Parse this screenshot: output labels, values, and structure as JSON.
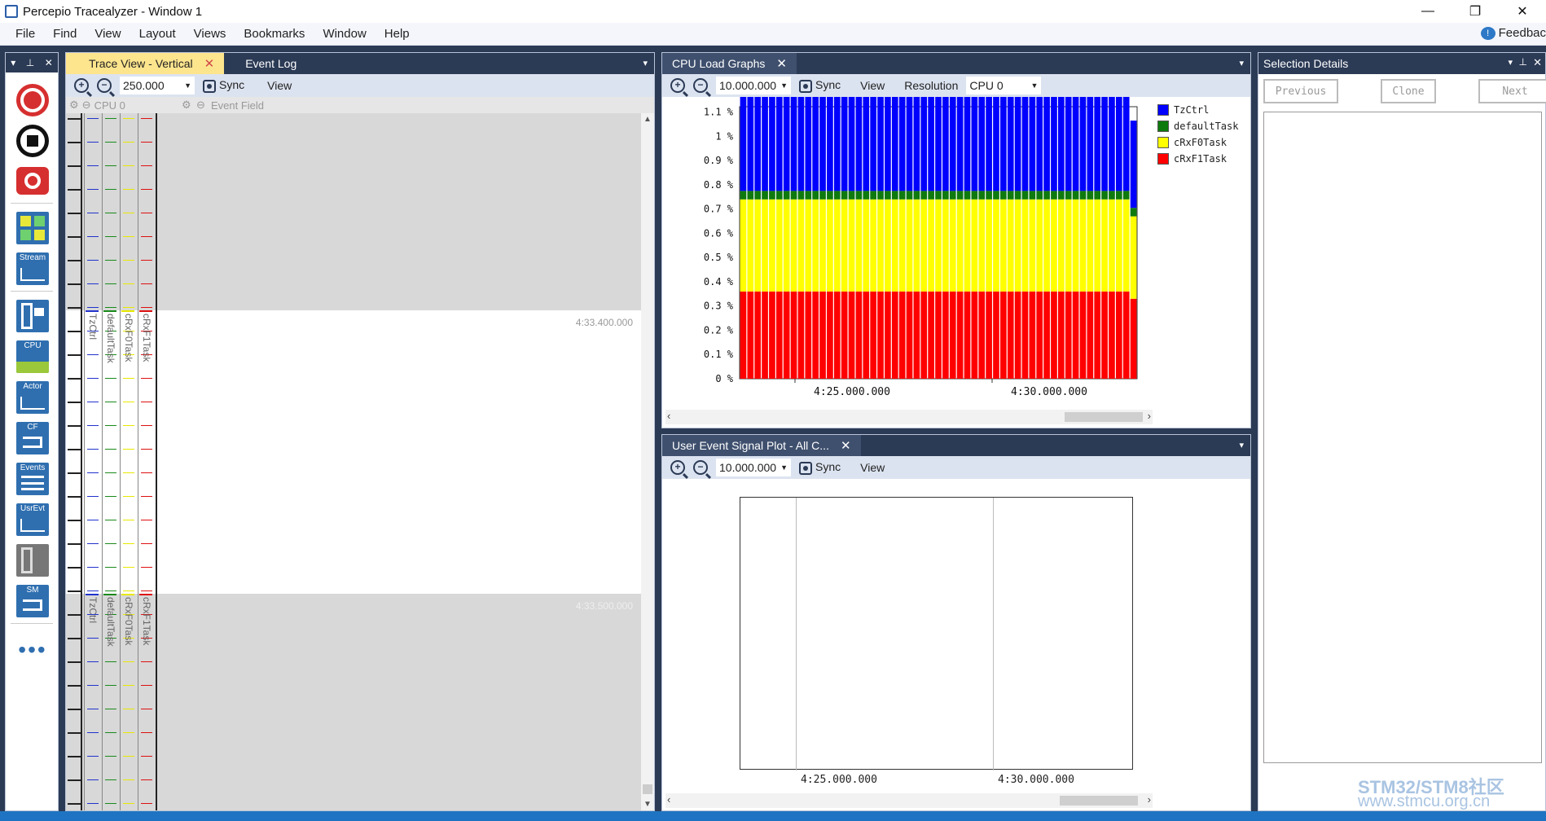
{
  "app": {
    "title": "Percepio Tracealyzer - Window 1",
    "win_min": "—",
    "win_max": "❐",
    "win_close": "✕"
  },
  "menu": [
    "File",
    "Find",
    "View",
    "Layout",
    "Views",
    "Bookmarks",
    "Window",
    "Help"
  ],
  "feedback": {
    "label": "Feedbac",
    "icon": "feedback-icon"
  },
  "toolbox": {
    "header_icons": [
      "dropdown-icon",
      "pin-icon",
      "close-icon"
    ],
    "tools": [
      {
        "name": "record-icon"
      },
      {
        "name": "stop-icon"
      },
      {
        "name": "snapshot-icon"
      },
      {
        "name": "dashboard-icon"
      },
      {
        "name": "stream-icon",
        "label": "Stream"
      },
      {
        "name": "trace-view-icon"
      },
      {
        "name": "cpu-load-icon",
        "label": "CPU"
      },
      {
        "name": "actor-icon",
        "label": "Actor"
      },
      {
        "name": "communication-flow-icon",
        "label": "CF"
      },
      {
        "name": "events-icon",
        "label": "Events"
      },
      {
        "name": "user-events-icon",
        "label": "UsrEvt"
      },
      {
        "name": "object-history-icon"
      },
      {
        "name": "state-machine-icon",
        "label": "SM"
      },
      {
        "name": "more-icon",
        "label": "•••"
      }
    ]
  },
  "trace_panel": {
    "tabs": [
      {
        "label": "Trace View - Vertical",
        "close": "✕"
      },
      {
        "label": "Event Log"
      }
    ],
    "zoom_value": "250.000",
    "sync_label": "Sync",
    "view_label": "View",
    "header_cpu": "CPU 0",
    "header_field": "Event Field",
    "timestamps": [
      "4:33.400.000",
      "4:33.500.000"
    ],
    "lanes": [
      {
        "name": "TzCtrl",
        "color": "#2233cc"
      },
      {
        "name": "defaultTask",
        "color": "#1a8a1a"
      },
      {
        "name": "cRxF0Task",
        "color": "#e8e800"
      },
      {
        "name": "cRxF1Task",
        "color": "#dd1111"
      }
    ]
  },
  "cpu_panel": {
    "tab": {
      "label": "CPU Load Graphs",
      "close": "✕"
    },
    "zoom_value": "10.000.000",
    "sync_label": "Sync",
    "view_label": "View",
    "resolution_label": "Resolution",
    "cpu_select": "CPU 0",
    "x_ticks": [
      "4:25.000.000",
      "4:30.000.000"
    ]
  },
  "user_event_panel": {
    "tab": {
      "label": "User Event Signal Plot - All C...",
      "close": "✕"
    },
    "zoom_value": "10.000.000",
    "sync_label": "Sync",
    "view_label": "View",
    "x_ticks": [
      "4:25.000.000",
      "4:30.000.000"
    ]
  },
  "selection_panel": {
    "title": "Selection Details",
    "buttons": [
      "Previous",
      "Clone",
      "Next"
    ],
    "watermark_line1": "STM32/STM8社区",
    "watermark_line2": "www.stmcu.org.cn"
  },
  "chart_data": {
    "type": "bar",
    "stacked": true,
    "yunit": "%",
    "y_ticks": [
      "0 %",
      "0.1 %",
      "0.2 %",
      "0.3 %",
      "0.4 %",
      "0.5 %",
      "0.6 %",
      "0.7 %",
      "0.8 %",
      "0.9 %",
      "1 %",
      "1.1 %"
    ],
    "ylim": [
      0,
      1.1
    ],
    "x_tick_labels": [
      "4:25.000.000",
      "4:30.000.000"
    ],
    "series": [
      {
        "name": "cRxF1Task",
        "color": "#ff0000",
        "value": 0.36,
        "last": 0.33
      },
      {
        "name": "cRxF0Task",
        "color": "#ffff00",
        "value": 0.38,
        "last": 0.34
      },
      {
        "name": "defaultTask",
        "color": "#0e7a0e",
        "value": 0.035,
        "last": 0.035
      },
      {
        "name": "TzCtrl",
        "color": "#0000ff",
        "value": 0.42,
        "last": 0.36
      }
    ],
    "bar_count": 55,
    "legend": [
      "TzCtrl",
      "defaultTask",
      "cRxF0Task",
      "cRxF1Task"
    ],
    "legend_position": "right"
  }
}
